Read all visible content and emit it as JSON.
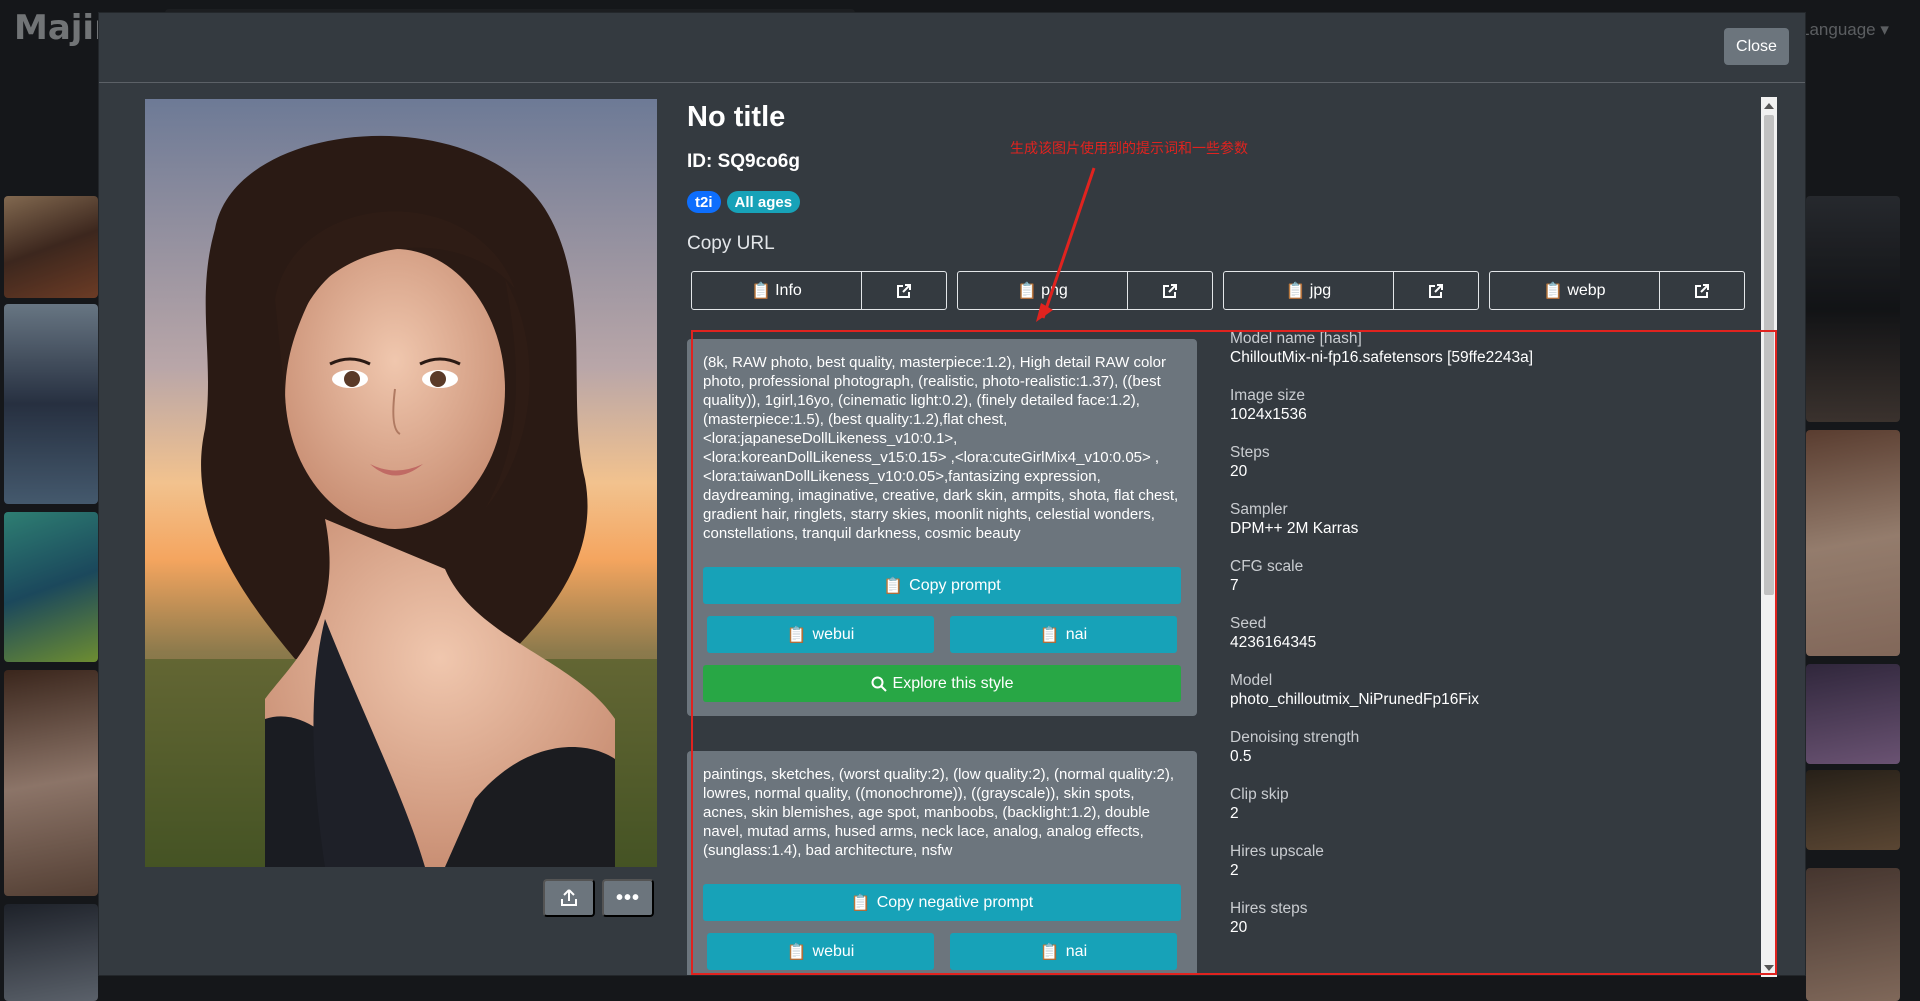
{
  "background": {
    "logo": "Majin",
    "language_menu": "Language"
  },
  "modal": {
    "close_label": "Close",
    "title": "No title",
    "id_line": "ID: SQ9co6g",
    "badges": [
      "t2i",
      "All ages"
    ],
    "copy_url_label": "Copy URL",
    "url_buttons": [
      "Info",
      "png",
      "jpg",
      "webp"
    ],
    "prompt": "(8k, RAW photo, best quality, masterpiece:1.2), High detail RAW color photo, professional photograph, (realistic, photo-realistic:1.37), ((best quality)), 1girl,16yo, (cinematic light:0.2), (finely detailed face:1.2), (masterpiece:1.5), (best quality:1.2),flat chest, <lora:japaneseDollLikeness_v10:0.1>, <lora:koreanDollLikeness_v15:0.15> ,<lora:cuteGirlMix4_v10:0.05> ,<lora:taiwanDollLikeness_v10:0.05>,fantasizing expression, daydreaming, imaginative, creative, dark skin, armpits, shota, flat chest, gradient hair, ringlets, starry skies, moonlit nights, celestial wonders, constellations, tranquil darkness, cosmic beauty",
    "copy_prompt_label": "Copy prompt",
    "webui_label": "webui",
    "nai_label": "nai",
    "explore_label": "Explore this style",
    "negative_prompt": "paintings, sketches, (worst quality:2), (low quality:2), (normal quality:2), lowres, normal quality, ((monochrome)), ((grayscale)), skin spots, acnes, skin blemishes, age spot, manboobs, (backlight:1.2), double navel, mutad arms, hused arms, neck lace, analog, analog effects, (sunglass:1.4), bad architecture, nsfw",
    "copy_negative_label": "Copy negative prompt",
    "params": [
      {
        "label": "Model name [hash]",
        "value": "ChilloutMix-ni-fp16.safetensors [59ffe2243a]"
      },
      {
        "label": "Image size",
        "value": "1024x1536"
      },
      {
        "label": "Steps",
        "value": "20"
      },
      {
        "label": "Sampler",
        "value": "DPM++ 2M Karras"
      },
      {
        "label": "CFG scale",
        "value": "7"
      },
      {
        "label": "Seed",
        "value": "4236164345"
      },
      {
        "label": "Model",
        "value": "photo_chilloutmix_NiPrunedFp16Fix"
      },
      {
        "label": "Denoising strength",
        "value": "0.5"
      },
      {
        "label": "Clip skip",
        "value": "2"
      },
      {
        "label": "Hires upscale",
        "value": "2"
      },
      {
        "label": "Hires steps",
        "value": "20"
      }
    ]
  },
  "annotation": {
    "text": "生成该图片使用到的提示词和一些参数",
    "color": "#e0231f"
  },
  "colors": {
    "teal": "#17a2b8",
    "green": "#28a745",
    "badge_blue": "#0d6efd",
    "modal_bg": "#343a40"
  }
}
